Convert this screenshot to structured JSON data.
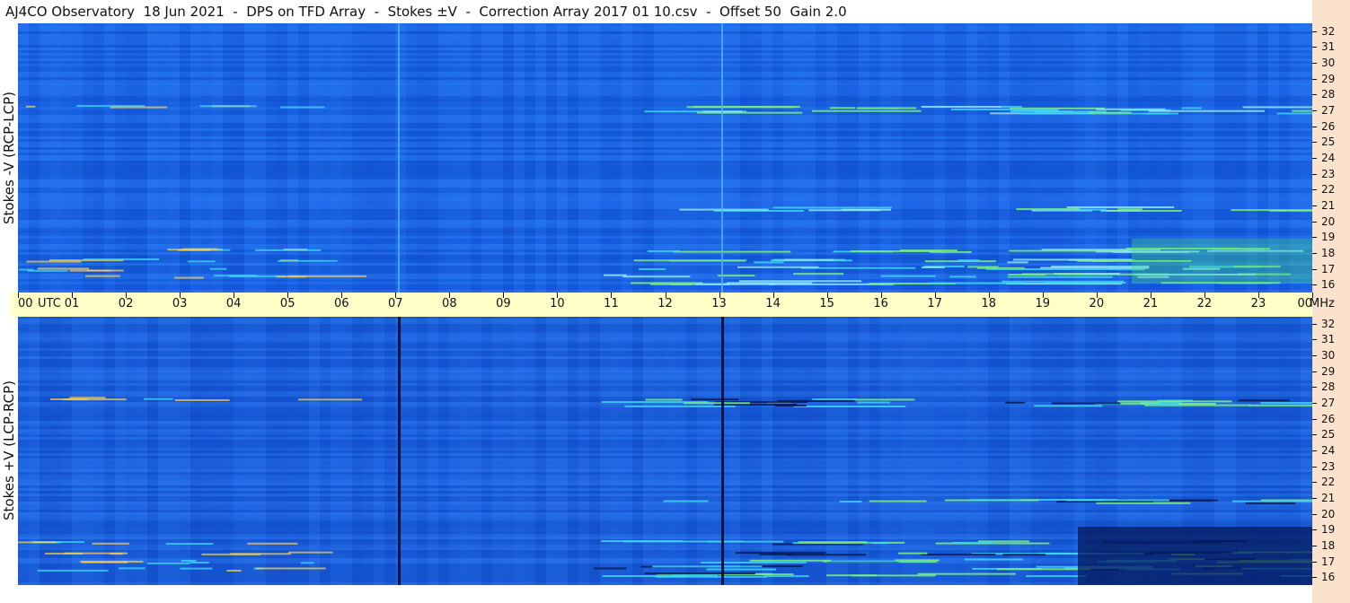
{
  "title": "AJ4CO Observatory  18 Jun 2021  -  DPS on TFD Array  -  Stokes ±V  -  Correction Array 2017 01 10.csv  -  Offset 50  Gain 2.0",
  "panels": [
    {
      "ylabel": "Stokes -V (RCP-LCP)",
      "bg": "#1a63e8"
    },
    {
      "ylabel": "Stokes +V (LCP-RCP)",
      "bg": "#1b5ad8"
    }
  ],
  "time_axis": {
    "labels": [
      "00",
      "01",
      "02",
      "03",
      "04",
      "05",
      "06",
      "07",
      "08",
      "09",
      "10",
      "11",
      "12",
      "13",
      "14",
      "15",
      "16",
      "17",
      "18",
      "19",
      "20",
      "21",
      "22",
      "23",
      "00"
    ],
    "utc_label": "UTC",
    "unit_label": "MHz"
  },
  "freq_axis": {
    "labels": [
      "32",
      "31",
      "30",
      "29",
      "28",
      "27",
      "26",
      "25",
      "24",
      "23",
      "22",
      "21",
      "20",
      "19",
      "18",
      "17",
      "16"
    ]
  }
}
